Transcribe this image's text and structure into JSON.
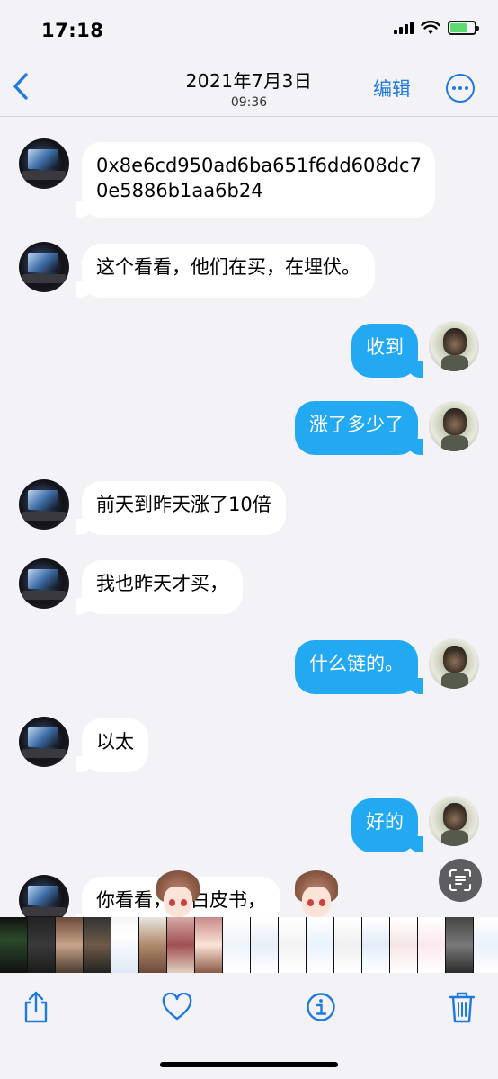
{
  "status_bar": {
    "time": "17:18"
  },
  "nav": {
    "date": "2021年7月3日",
    "time": "09:36",
    "edit_label": "编辑"
  },
  "messages": [
    {
      "side": "in",
      "lines": [
        "0x8e6cd950ad6ba651f6dd608dc7",
        "0e5886b1aa6b24"
      ]
    },
    {
      "side": "in",
      "lines": [
        "这个看看，他们在买，在埋伏。"
      ]
    },
    {
      "side": "out",
      "lines": [
        "收到"
      ]
    },
    {
      "side": "out",
      "lines": [
        "涨了多少了"
      ]
    },
    {
      "side": "in",
      "lines": [
        "前天到昨天涨了10倍"
      ]
    },
    {
      "side": "in",
      "lines": [
        "我也昨天才买，"
      ]
    },
    {
      "side": "out",
      "lines": [
        "什么链的。"
      ]
    },
    {
      "side": "in",
      "lines": [
        "以太"
      ]
    },
    {
      "side": "out",
      "lines": [
        "好的"
      ]
    },
    {
      "side": "in",
      "lines": [
        "你看看，有白皮书，"
      ]
    }
  ],
  "icons": {
    "back": "chevron-left-icon",
    "more": "ellipsis-circle-icon",
    "scan": "live-text-icon",
    "share": "share-icon",
    "favorite": "heart-icon",
    "info": "info-icon",
    "delete": "trash-icon"
  },
  "colors": {
    "accent": "#1f7ae0",
    "outgoing_bubble": "#23a8f2",
    "incoming_bubble": "#ffffff",
    "background": "#f2f2f7"
  }
}
